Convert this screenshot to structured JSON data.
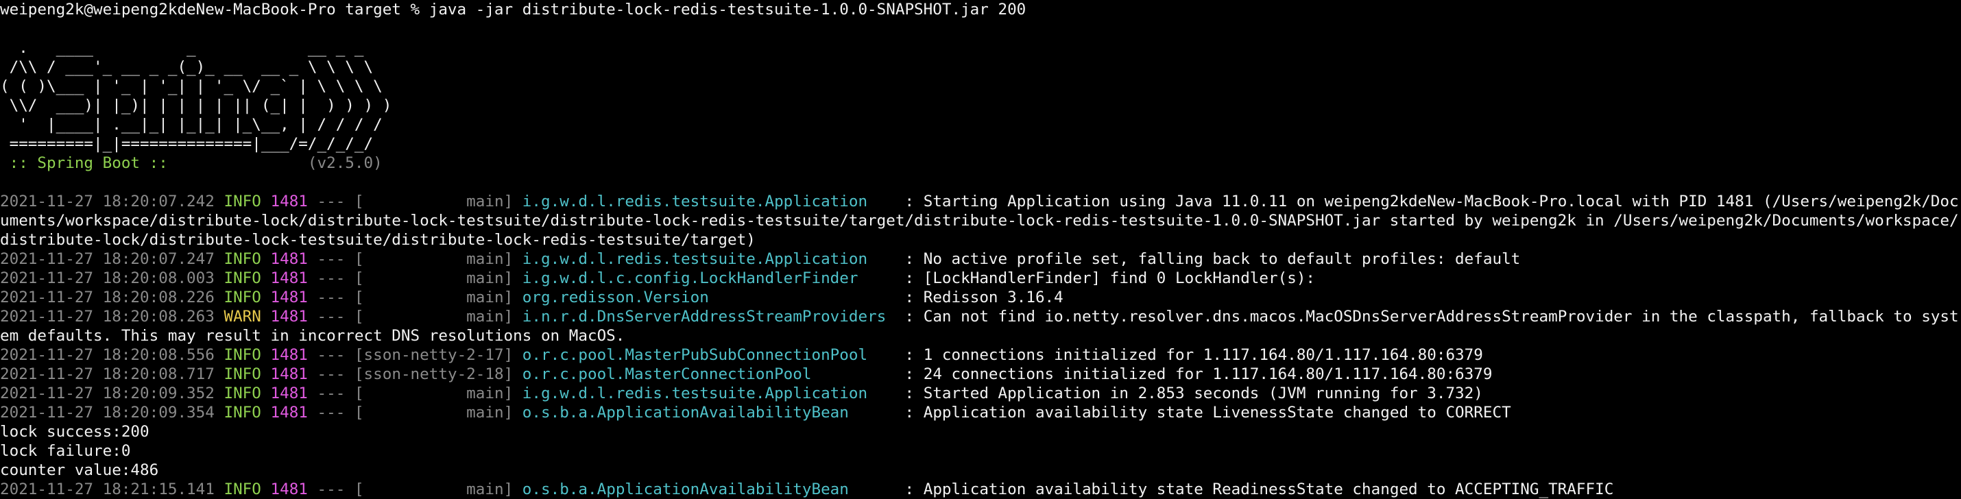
{
  "prompt": "weipeng2k@weipeng2kdeNew-MacBook-Pro target % java -jar distribute-lock-redis-testsuite-1.0.0-SNAPSHOT.jar 200",
  "banner": [
    "  .   ____          _            __ _ _",
    " /\\\\ / ___'_ __ _ _(_)_ __  __ _ \\ \\ \\ \\",
    "( ( )\\___ | '_ | '_| | '_ \\/ _` | \\ \\ \\ \\",
    " \\\\/  ___)| |_)| | | | | || (_| |  ) ) ) )",
    "  '  |____| .__|_| |_|_| |_\\__, | / / / /",
    " =========|_|==============|___/=/_/_/_/"
  ],
  "spring_label": " :: Spring Boot :: ",
  "spring_version": "              (v2.5.0)",
  "logs": [
    {
      "ts": "2021-11-27 18:20:07.242",
      "level": " INFO",
      "level_type": "info",
      "pid": "1481",
      "sep": " --- ",
      "thread": "[           main]",
      "logger": "i.g.w.d.l.redis.testsuite.Application   ",
      "msg": " : Starting Application using Java 11.0.11 on weipeng2kdeNew-MacBook-Pro.local with PID 1481 (/Users/weipeng2k/Documents/workspace/distribute-lock/distribute-lock-testsuite/distribute-lock-redis-testsuite/target/distribute-lock-redis-testsuite-1.0.0-SNAPSHOT.jar started by weipeng2k in /Users/weipeng2k/Documents/workspace/distribute-lock/distribute-lock-testsuite/distribute-lock-redis-testsuite/target)"
    },
    {
      "ts": "2021-11-27 18:20:07.247",
      "level": " INFO",
      "level_type": "info",
      "pid": "1481",
      "sep": " --- ",
      "thread": "[           main]",
      "logger": "i.g.w.d.l.redis.testsuite.Application   ",
      "msg": " : No active profile set, falling back to default profiles: default"
    },
    {
      "ts": "2021-11-27 18:20:08.003",
      "level": " INFO",
      "level_type": "info",
      "pid": "1481",
      "sep": " --- ",
      "thread": "[           main]",
      "logger": "i.g.w.d.l.c.config.LockHandlerFinder    ",
      "msg": " : [LockHandlerFinder] find 0 LockHandler(s):"
    },
    {
      "ts": "2021-11-27 18:20:08.226",
      "level": " INFO",
      "level_type": "info",
      "pid": "1481",
      "sep": " --- ",
      "thread": "[           main]",
      "logger": "org.redisson.Version                    ",
      "msg": " : Redisson 3.16.4"
    },
    {
      "ts": "2021-11-27 18:20:08.263",
      "level": " WARN",
      "level_type": "warn",
      "pid": "1481",
      "sep": " --- ",
      "thread": "[           main]",
      "logger": "i.n.r.d.DnsServerAddressStreamProviders ",
      "msg": " : Can not find io.netty.resolver.dns.macos.MacOSDnsServerAddressStreamProvider in the classpath, fallback to system defaults. This may result in incorrect DNS resolutions on MacOS."
    },
    {
      "ts": "2021-11-27 18:20:08.556",
      "level": " INFO",
      "level_type": "info",
      "pid": "1481",
      "sep": " --- ",
      "thread": "[sson-netty-2-17]",
      "logger": "o.r.c.pool.MasterPubSubConnectionPool   ",
      "msg": " : 1 connections initialized for 1.117.164.80/1.117.164.80:6379"
    },
    {
      "ts": "2021-11-27 18:20:08.717",
      "level": " INFO",
      "level_type": "info",
      "pid": "1481",
      "sep": " --- ",
      "thread": "[sson-netty-2-18]",
      "logger": "o.r.c.pool.MasterConnectionPool         ",
      "msg": " : 24 connections initialized for 1.117.164.80/1.117.164.80:6379"
    },
    {
      "ts": "2021-11-27 18:20:09.352",
      "level": " INFO",
      "level_type": "info",
      "pid": "1481",
      "sep": " --- ",
      "thread": "[           main]",
      "logger": "i.g.w.d.l.redis.testsuite.Application   ",
      "msg": " : Started Application in 2.853 seconds (JVM running for 3.732)"
    },
    {
      "ts": "2021-11-27 18:20:09.354",
      "level": " INFO",
      "level_type": "info",
      "pid": "1481",
      "sep": " --- ",
      "thread": "[           main]",
      "logger": "o.s.b.a.ApplicationAvailabilityBean     ",
      "msg": " : Application availability state LivenessState changed to CORRECT"
    }
  ],
  "output_lines": [
    "lock success:200",
    "lock failure:0",
    "counter value:486"
  ],
  "last_log": {
    "ts": "2021-11-27 18:21:15.141",
    "level": " INFO",
    "level_type": "info",
    "pid": "1481",
    "sep": " --- ",
    "thread": "[           main]",
    "logger": "o.s.b.a.ApplicationAvailabilityBean     ",
    "msg": " : Application availability state ReadinessState changed to ACCEPTING_TRAFFIC"
  },
  "colors": {
    "background": "#000000",
    "text": "#f2f2f2",
    "info": "#8fd14f",
    "warn": "#e6c84c",
    "pid": "#e05ae0",
    "logger": "#4fc1c9",
    "dim": "#8a8a8a"
  }
}
